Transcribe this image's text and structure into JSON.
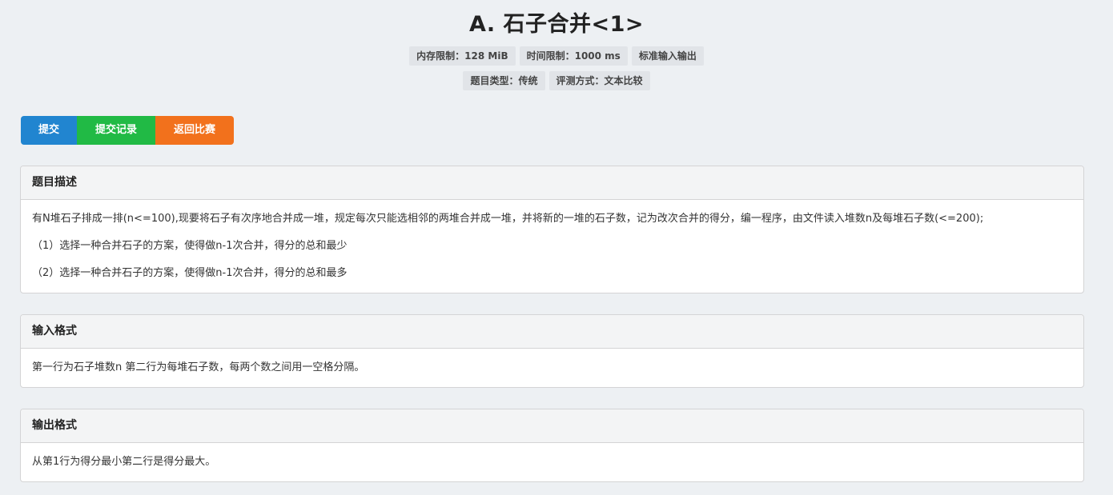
{
  "problem": {
    "title": "A. 石子合并<1>",
    "badges_row1": [
      "内存限制：128 MiB",
      "时间限制：1000 ms",
      "标准输入输出"
    ],
    "badges_row2": [
      "题目类型：传统",
      "评测方式：文本比较"
    ]
  },
  "actions": {
    "submit_label": "提交",
    "records_label": "提交记录",
    "back_label": "返回比赛"
  },
  "colors": {
    "submit": "#2185d0",
    "records": "#21ba45",
    "back": "#f2711c"
  },
  "sections": {
    "description": {
      "heading": "题目描述",
      "paragraphs": [
        "有N堆石子排成一排(n<=100),现要将石子有次序地合并成一堆，规定每次只能选相邻的两堆合并成一堆，并将新的一堆的石子数，记为改次合并的得分，编一程序，由文件读入堆数n及每堆石子数(<=200);",
        "（1）选择一种合并石子的方案，使得做n-1次合并，得分的总和最少",
        "（2）选择一种合并石子的方案，使得做n-1次合并，得分的总和最多"
      ]
    },
    "input": {
      "heading": "输入格式",
      "paragraphs": [
        "第一行为石子堆数n 第二行为每堆石子数，每两个数之间用一空格分隔。"
      ]
    },
    "output": {
      "heading": "输出格式",
      "paragraphs": [
        "从第1行为得分最小第二行是得分最大。"
      ]
    }
  }
}
